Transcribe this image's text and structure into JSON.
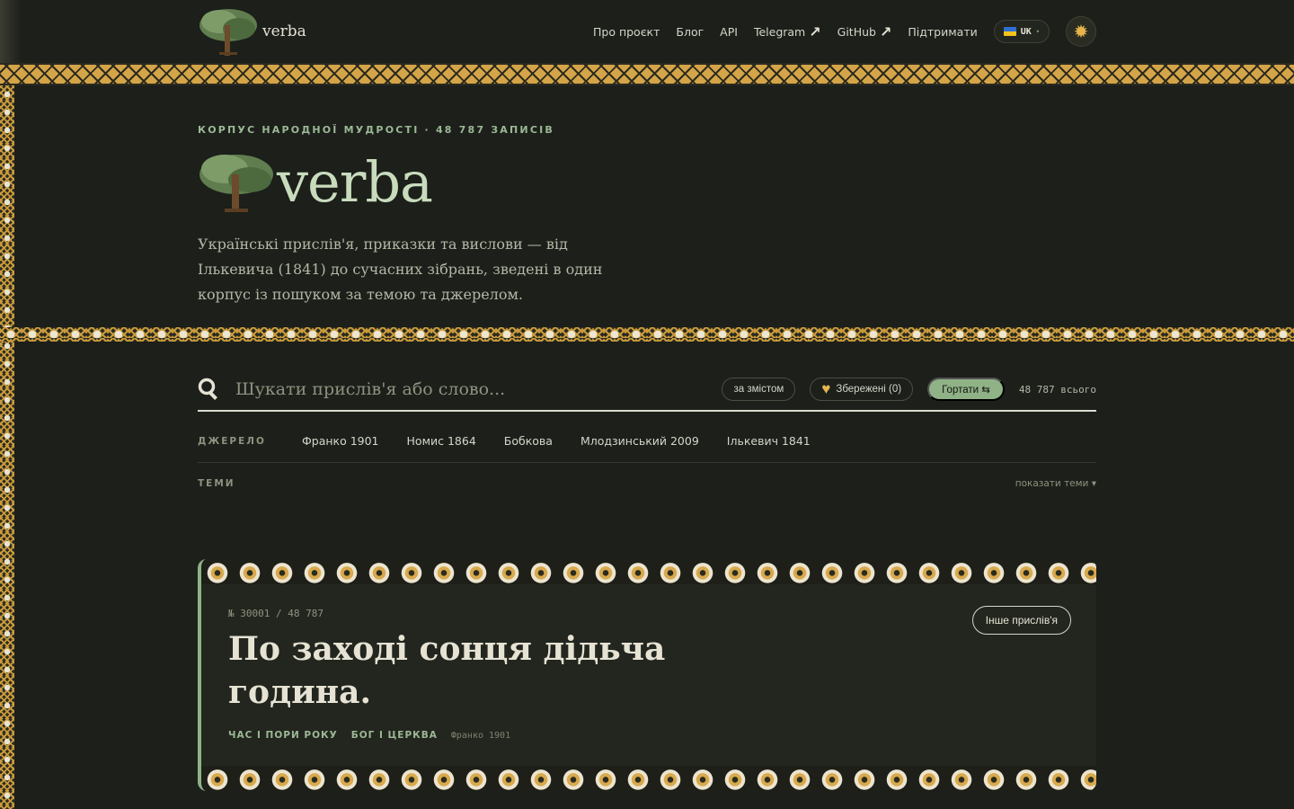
{
  "brand": {
    "name": "verba"
  },
  "nav": {
    "about": "Про проєкт",
    "blog": "Блог",
    "api": "API",
    "telegram": "Telegram",
    "github": "GitHub",
    "support": "Підтримати",
    "lang": "UK"
  },
  "hero": {
    "eyebrow": "КОРПУС НАРОДНОЇ МУДРОСТІ · 48 787 ЗАПИСІВ",
    "title": "verba",
    "tagline": "Українські прислів'я, приказки та вислови — від Ількевича (1841) до сучасних зібрань, зведені в один корпус із пошуком за темою та джерелом."
  },
  "search": {
    "placeholder": "Шукати прислів'я або слово...",
    "mode_chip": "за змістом",
    "saved": "Збережені (0)",
    "browse": "Гортати ⇆",
    "total": "48 787 всього"
  },
  "filters": {
    "source_label": "ДЖЕРЕЛО",
    "sources": [
      "Франко 1901",
      "Номис 1864",
      "Бобкова",
      "Млодзинський 2009",
      "Ількевич 1841"
    ],
    "themes_label": "ТЕМИ",
    "themes_toggle": "показати теми ▾"
  },
  "card": {
    "index": "№ 30001 / 48 787",
    "text": "По заході сонця дідьча година.",
    "tags": [
      "ЧАС І ПОРИ РОКУ",
      "БОГ І ЦЕРКВА"
    ],
    "source": "Франко 1901",
    "another": "Інше прислів'я"
  },
  "colors": {
    "background": "#1c1f1a",
    "accent_green": "#8fb287",
    "ornament_gold": "#d4a448"
  },
  "icons": {
    "logo": "willow-tree-icon",
    "external": "arrow-up-right-icon",
    "search": "magnifier-icon",
    "saved": "heart-icon",
    "theme": "sun-icon"
  }
}
